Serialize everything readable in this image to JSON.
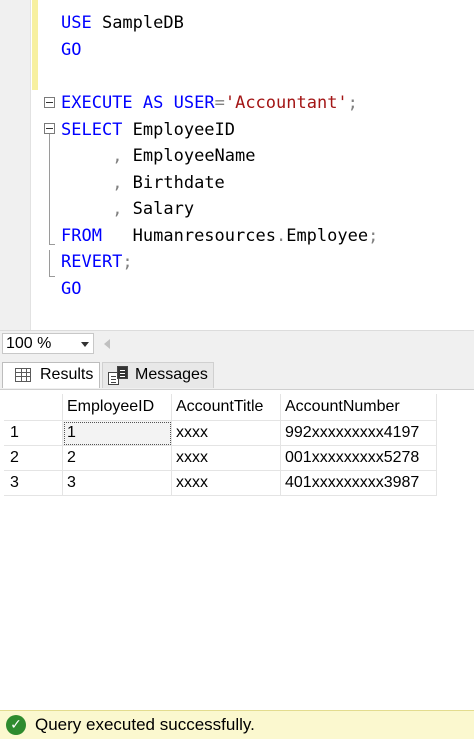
{
  "editor": {
    "lines": {
      "l1": {
        "kw": "USE",
        "rest": " SampleDB"
      },
      "l2": {
        "kw": "GO"
      },
      "l3": {
        "kw1": "EXECUTE",
        "sp1": " ",
        "kw2": "AS",
        "sp2": " ",
        "kw3": "USER",
        "eq": "=",
        "str": "'Accountant'",
        "end": ";"
      },
      "l4": {
        "kw": "SELECT",
        "rest": " EmployeeID"
      },
      "l5": {
        "indent": "     ",
        "comma": ",",
        "rest": " EmployeeName"
      },
      "l6": {
        "indent": "     ",
        "comma": ",",
        "rest": " Birthdate"
      },
      "l7": {
        "indent": "     ",
        "comma": ",",
        "rest": " Salary"
      },
      "l8": {
        "kw": "FROM",
        "mid": "   Humanresources",
        "dot": ".",
        "rest": "Employee",
        "end": ";"
      },
      "l9": {
        "kw": "REVERT",
        "end": ";"
      },
      "l10": {
        "kw": "GO"
      }
    }
  },
  "zoom": {
    "value": "100 %"
  },
  "tabs": {
    "results": "Results",
    "messages": "Messages"
  },
  "results": {
    "columns": [
      "EmployeeID",
      "AccountTitle",
      "AccountNumber"
    ],
    "rows": [
      {
        "num": "1",
        "EmployeeID": "1",
        "AccountTitle": "xxxx",
        "AccountNumber": "992xxxxxxxxx4197"
      },
      {
        "num": "2",
        "EmployeeID": "2",
        "AccountTitle": "xxxx",
        "AccountNumber": "001xxxxxxxxx5278"
      },
      {
        "num": "3",
        "EmployeeID": "3",
        "AccountTitle": "xxxx",
        "AccountNumber": "401xxxxxxxxx3987"
      }
    ]
  },
  "status": {
    "text": "Query executed successfully."
  },
  "colors": {
    "keyword": "#0000ff",
    "string": "#a31515",
    "operator": "#808080",
    "status_bg": "#fbf8cf",
    "status_icon": "#2e8b2e"
  }
}
